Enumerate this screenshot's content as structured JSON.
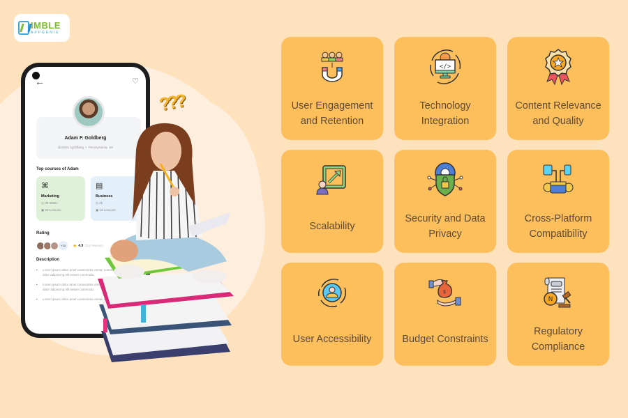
{
  "brand": {
    "logo_main": "IMBLE",
    "logo_prefix": "N",
    "logo_sub": "APPGENIE",
    "accent_green": "#7bbd2e",
    "accent_blue": "#3fa6d6"
  },
  "phone": {
    "profile": {
      "name": "Adam F. Goldberg",
      "handle": "@adam.f.goldberg",
      "separator": "•",
      "location": "Pennsylvania, US"
    },
    "courses_title": "Top courses of Adam",
    "courses": [
      {
        "title": "Marketing",
        "duration": "3h 30Min",
        "lessons": "22 Lessons",
        "icon": "network-icon"
      },
      {
        "title": "Business",
        "duration": "2h",
        "lessons": "18 Lessons",
        "icon": "briefcase-icon"
      }
    ],
    "rating_title": "Rating",
    "rating": {
      "more_count": "+15",
      "score": "4.9",
      "reviews": "(112 reviews)"
    },
    "description_title": "Description",
    "description_items": [
      "Lorem ipsum dolor amet consectetur enean commodo. Lorem ipsum dolor adipiscing elit enean commodo.",
      "Lorem ipsum dolor amet consectetur enean commodo. Lorem ipsum dolor adipiscing elit enean commodo.",
      "Lorem ipsum dolor amet consectetur enean commodo."
    ]
  },
  "illustration": {
    "question_marks": "???"
  },
  "cards": [
    {
      "label": "User Engagement and Retention",
      "icon": "magnet-users-icon"
    },
    {
      "label": "Technology Integration",
      "icon": "code-monitor-icon"
    },
    {
      "label": "Content Relevance and Quality",
      "icon": "award-badge-icon"
    },
    {
      "label": "Scalability",
      "icon": "growth-chart-icon"
    },
    {
      "label": "Security and Data Privacy",
      "icon": "shield-lock-icon"
    },
    {
      "label": "Cross-Platform Compatibility",
      "icon": "devices-sync-icon"
    },
    {
      "label": "User Accessibility",
      "icon": "user-cycle-icon"
    },
    {
      "label": "Budget Constraints",
      "icon": "money-bag-icon"
    },
    {
      "label": "Regulatory Compliance",
      "icon": "gavel-document-icon"
    }
  ],
  "colors": {
    "background": "#fde2bd",
    "card": "#fdbe5c",
    "card_text": "#5d4a37"
  }
}
